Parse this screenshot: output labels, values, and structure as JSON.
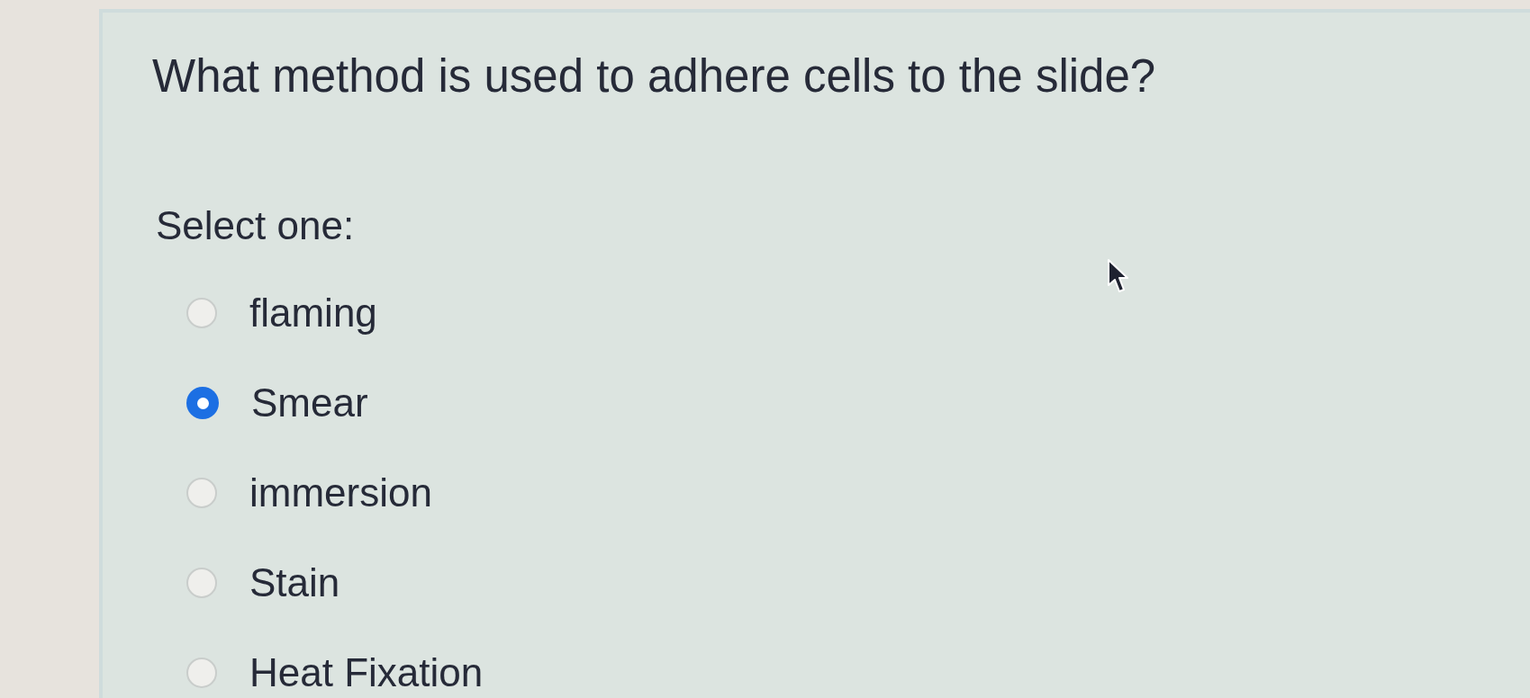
{
  "question": {
    "text": "What method is used to adhere cells to the slide?"
  },
  "prompt": "Select one:",
  "options": [
    {
      "label": "flaming",
      "selected": false
    },
    {
      "label": "Smear",
      "selected": true
    },
    {
      "label": "immersion",
      "selected": false
    },
    {
      "label": "Stain",
      "selected": false
    },
    {
      "label": "Heat Fixation",
      "selected": false
    }
  ]
}
